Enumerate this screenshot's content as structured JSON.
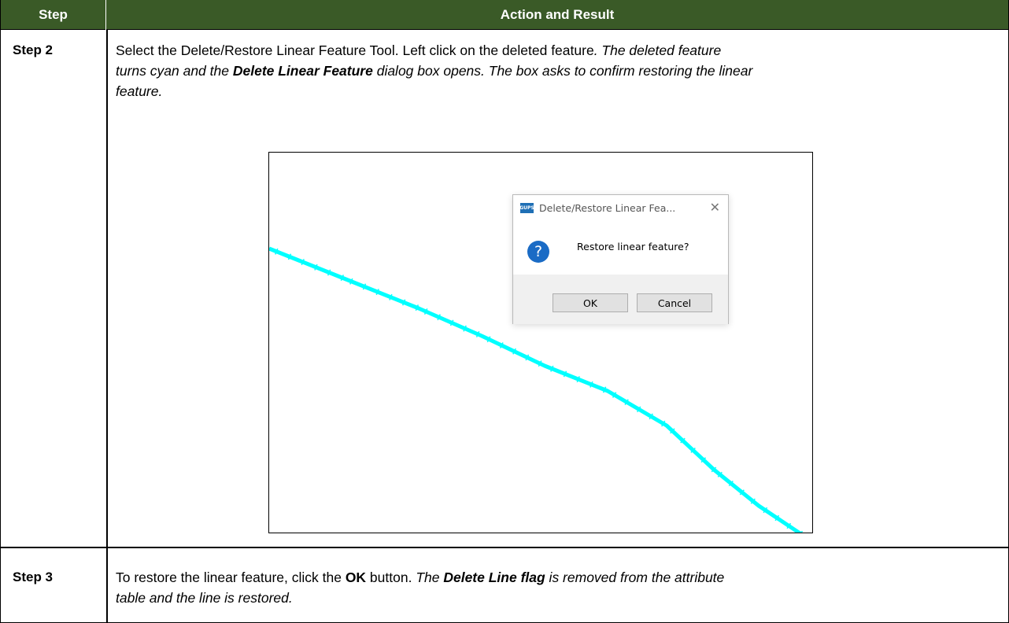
{
  "table": {
    "header": {
      "step": "Step",
      "action": "Action and Result"
    },
    "rows": [
      {
        "step": "Step 2",
        "line1_plain": "Select the Delete/Restore Linear Feature Tool. Left click on the deleted feature",
        "line1_italic": ". The deleted feature",
        "line2_italic_a": "turns cyan and the ",
        "line2_bold": "Delete Linear Feature",
        "line2_italic_b": " dialog box opens. The box asks to confirm restoring the linear",
        "line3_italic": "feature."
      },
      {
        "step": "Step 3",
        "line1_plain_a": "To restore the linear feature, click the ",
        "line1_bold": "OK",
        "line1_plain_b": " button. ",
        "line1_italic_a": "The ",
        "line1_bold_italic": "Delete Line flag",
        "line1_italic_b": " is removed from the attribute",
        "line2_italic": "table and the line is restored."
      }
    ]
  },
  "screenshot": {
    "line_color": "#00ffff",
    "dialog": {
      "app_icon_text": "GUPS",
      "title": "Delete/Restore Linear Fea...",
      "close_glyph": "✕",
      "question_glyph": "?",
      "message": "Restore linear feature?",
      "ok_label": "OK",
      "cancel_label": "Cancel"
    }
  },
  "colors": {
    "header_bg": "#3a5a27",
    "header_text": "#ffffff",
    "question_icon": "#1a6bc5"
  }
}
